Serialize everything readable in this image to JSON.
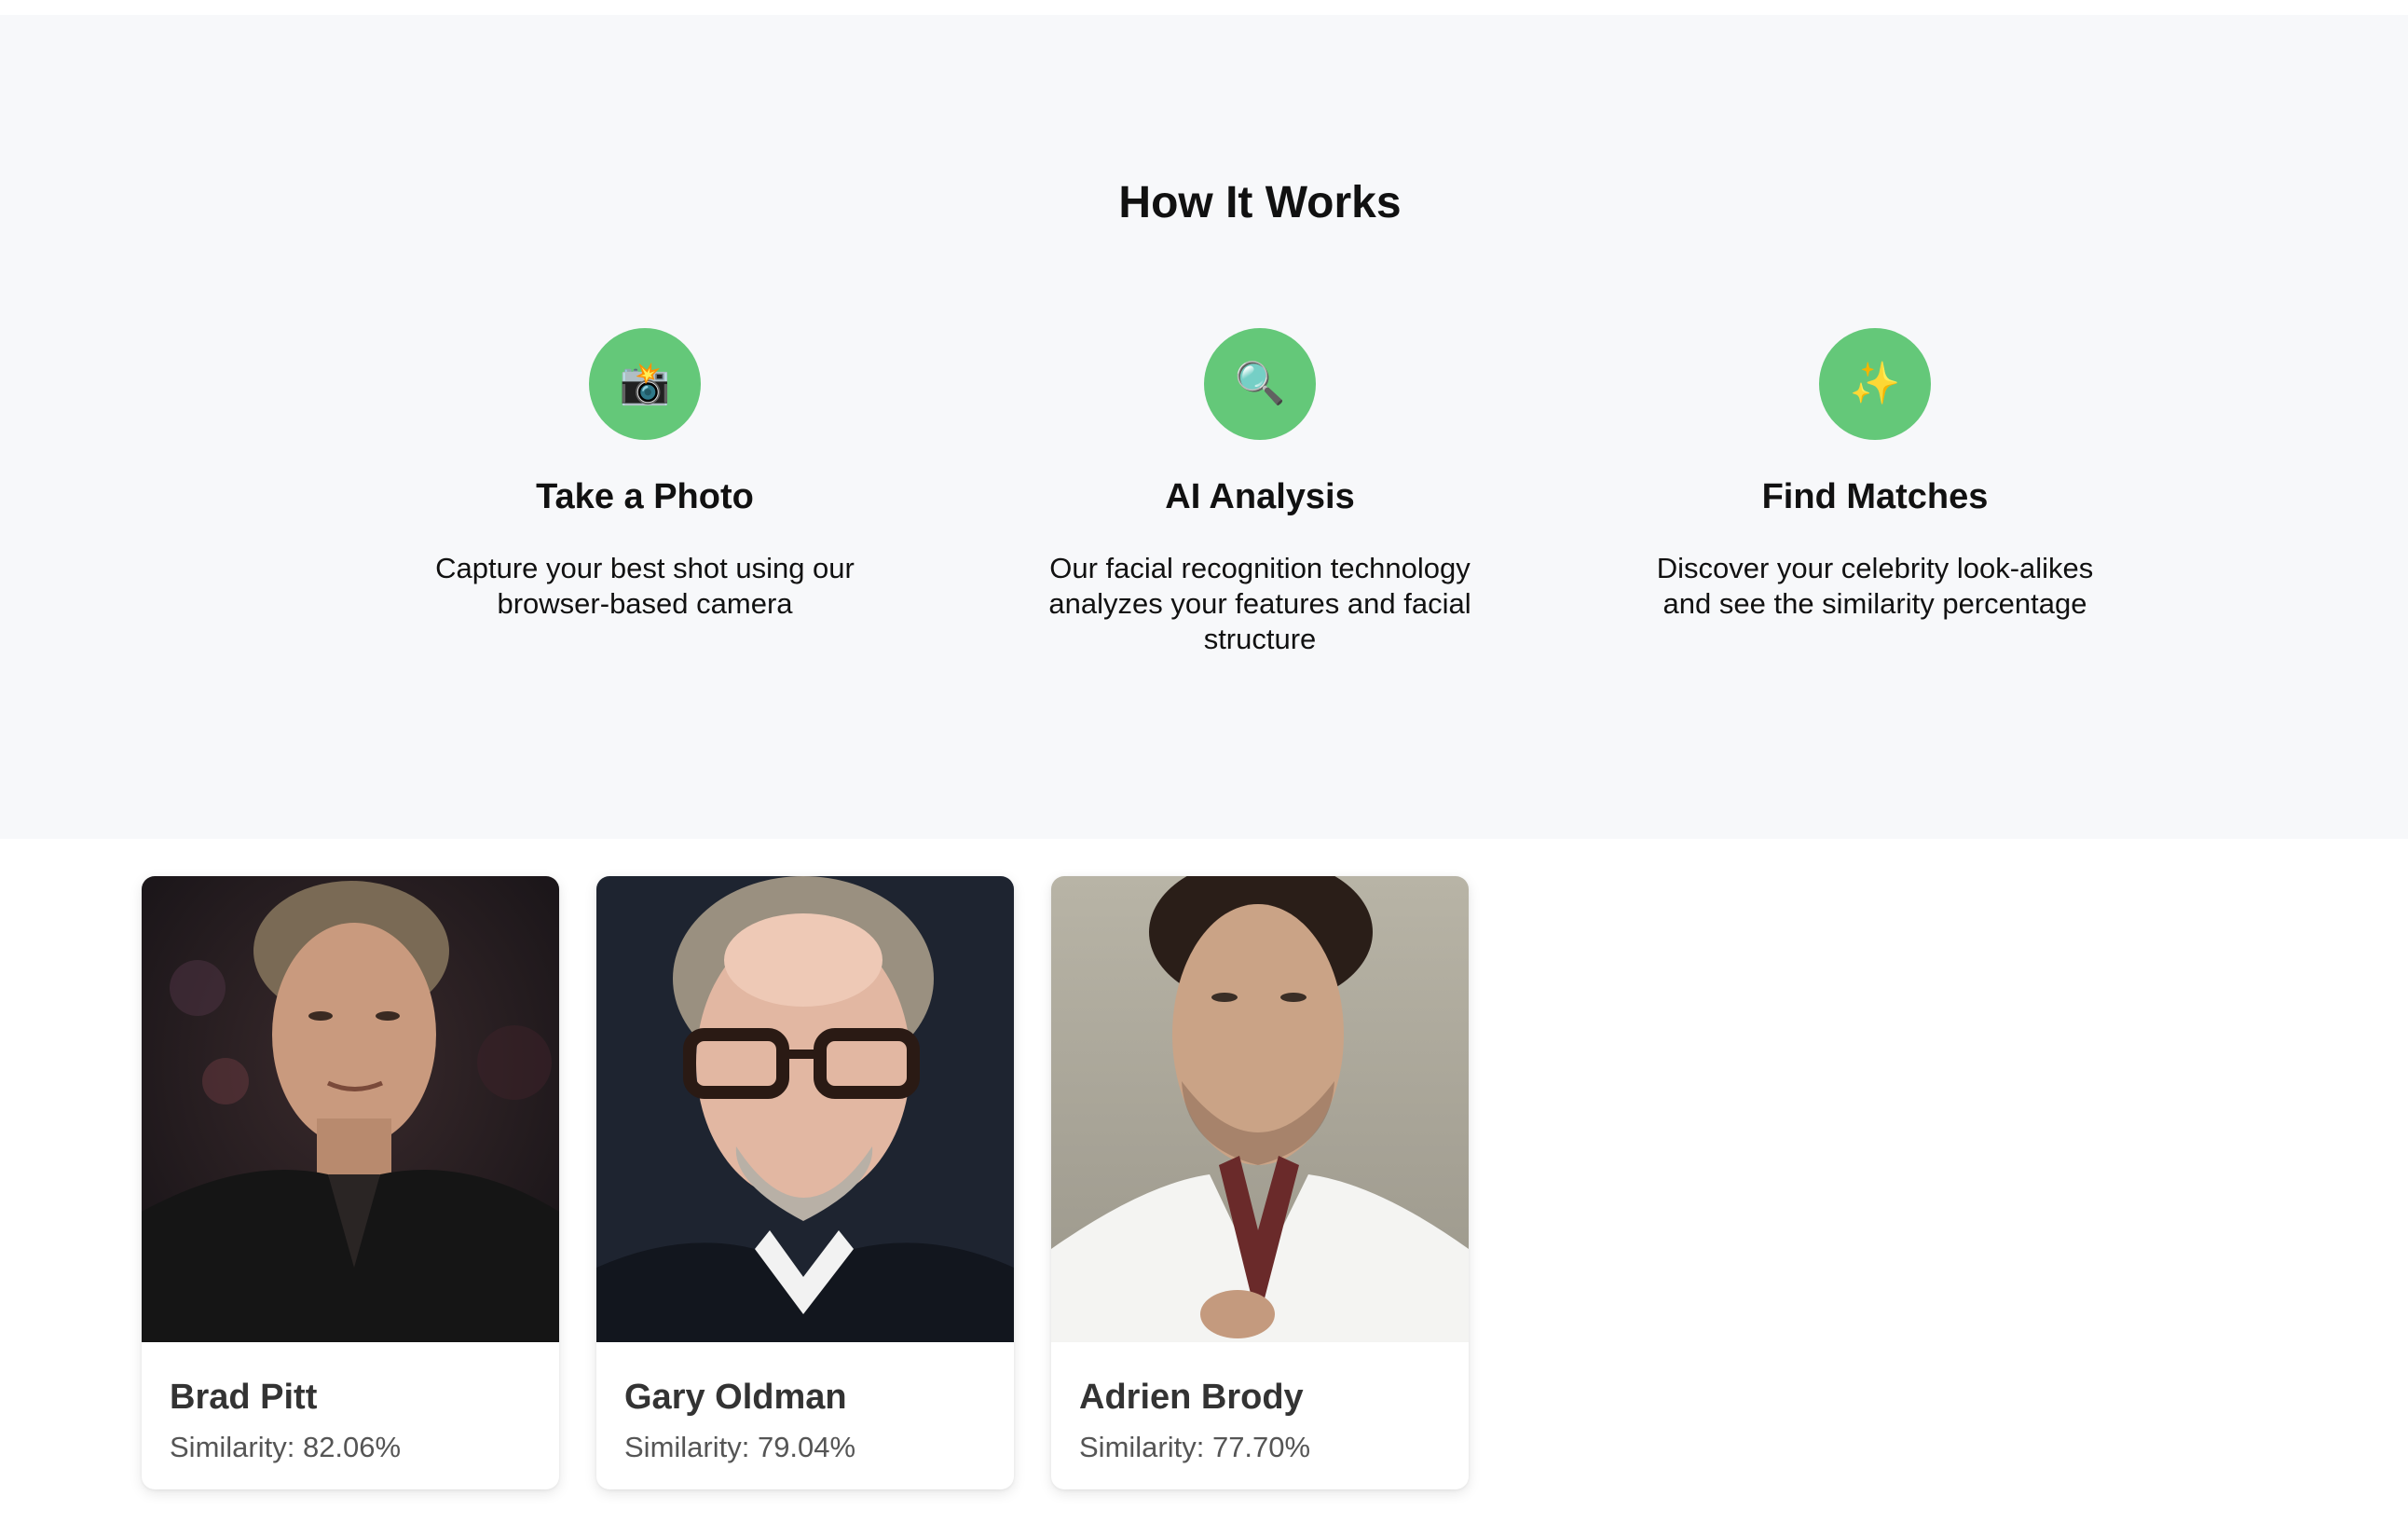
{
  "how_it_works": {
    "title": "How It Works",
    "accent_color": "#64c879",
    "steps": [
      {
        "icon": "camera-flash-icon",
        "glyph": "📸",
        "title": "Take a Photo",
        "description": "Capture your best shot using our browser-based camera"
      },
      {
        "icon": "magnifier-icon",
        "glyph": "🔍",
        "title": "AI Analysis",
        "description": "Our facial recognition technology analyzes your features and facial structure"
      },
      {
        "icon": "sparkles-icon",
        "glyph": "✨",
        "title": "Find Matches",
        "description": "Discover your celebrity look-alikes and see the similarity percentage"
      }
    ]
  },
  "matches": [
    {
      "name": "Brad Pitt",
      "similarity": "Similarity: 82.06%"
    },
    {
      "name": "Gary Oldman",
      "similarity": "Similarity: 79.04%"
    },
    {
      "name": "Adrien Brody",
      "similarity": "Similarity: 77.70%"
    }
  ]
}
